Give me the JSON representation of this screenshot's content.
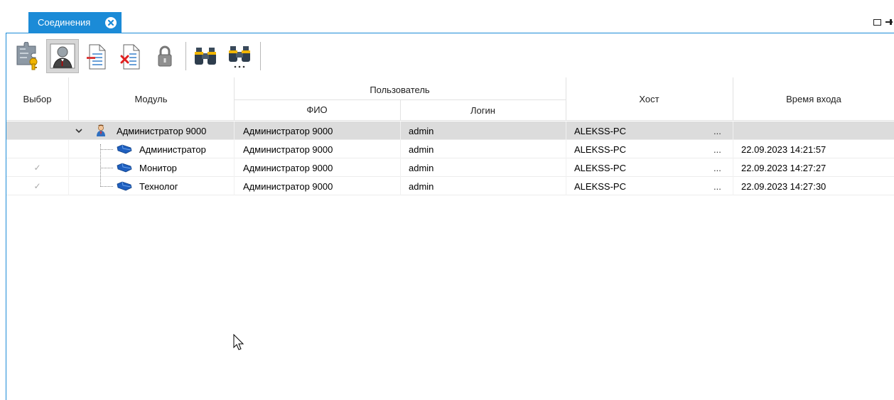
{
  "tab": {
    "label": "Соединения"
  },
  "toolbar": {
    "buttons": [
      {
        "icon": "puzzle-key-icon"
      },
      {
        "icon": "user-icon",
        "active": true
      },
      {
        "icon": "document-remove-icon"
      },
      {
        "icon": "document-delete-icon"
      },
      {
        "icon": "lock-icon"
      },
      {
        "icon": "binoculars-icon"
      },
      {
        "icon": "binoculars-next-icon"
      }
    ]
  },
  "grid": {
    "headers": {
      "select": "Выбор",
      "module": "Модуль",
      "user_group": "Пользователь",
      "fio": "ФИО",
      "login": "Логин",
      "host": "Хост",
      "login_time": "Время входа"
    },
    "rows": [
      {
        "module": "Администратор 9000",
        "fio": "Администратор 9000",
        "login": "admin",
        "host": "ALEKSS-PC",
        "dots": "...",
        "time": "",
        "checked": "",
        "level": 0,
        "selected": true
      },
      {
        "module": "Администратор",
        "fio": "Администратор 9000",
        "login": "admin",
        "host": "ALEKSS-PC",
        "dots": "...",
        "time": "22.09.2023 14:21:57",
        "checked": "",
        "level": 1,
        "selected": false
      },
      {
        "module": "Монитор",
        "fio": "Администратор 9000",
        "login": "admin",
        "host": "ALEKSS-PC",
        "dots": "...",
        "time": "22.09.2023 14:27:27",
        "checked": "✓",
        "level": 1,
        "selected": false
      },
      {
        "module": "Технолог",
        "fio": "Администратор 9000",
        "login": "admin",
        "host": "ALEKSS-PC",
        "dots": "...",
        "time": "22.09.2023 14:27:30",
        "checked": "✓",
        "level": 1,
        "selected": false
      }
    ]
  },
  "colors": {
    "accent": "#1b8bd7",
    "selected_row": "#dcdcdc"
  }
}
